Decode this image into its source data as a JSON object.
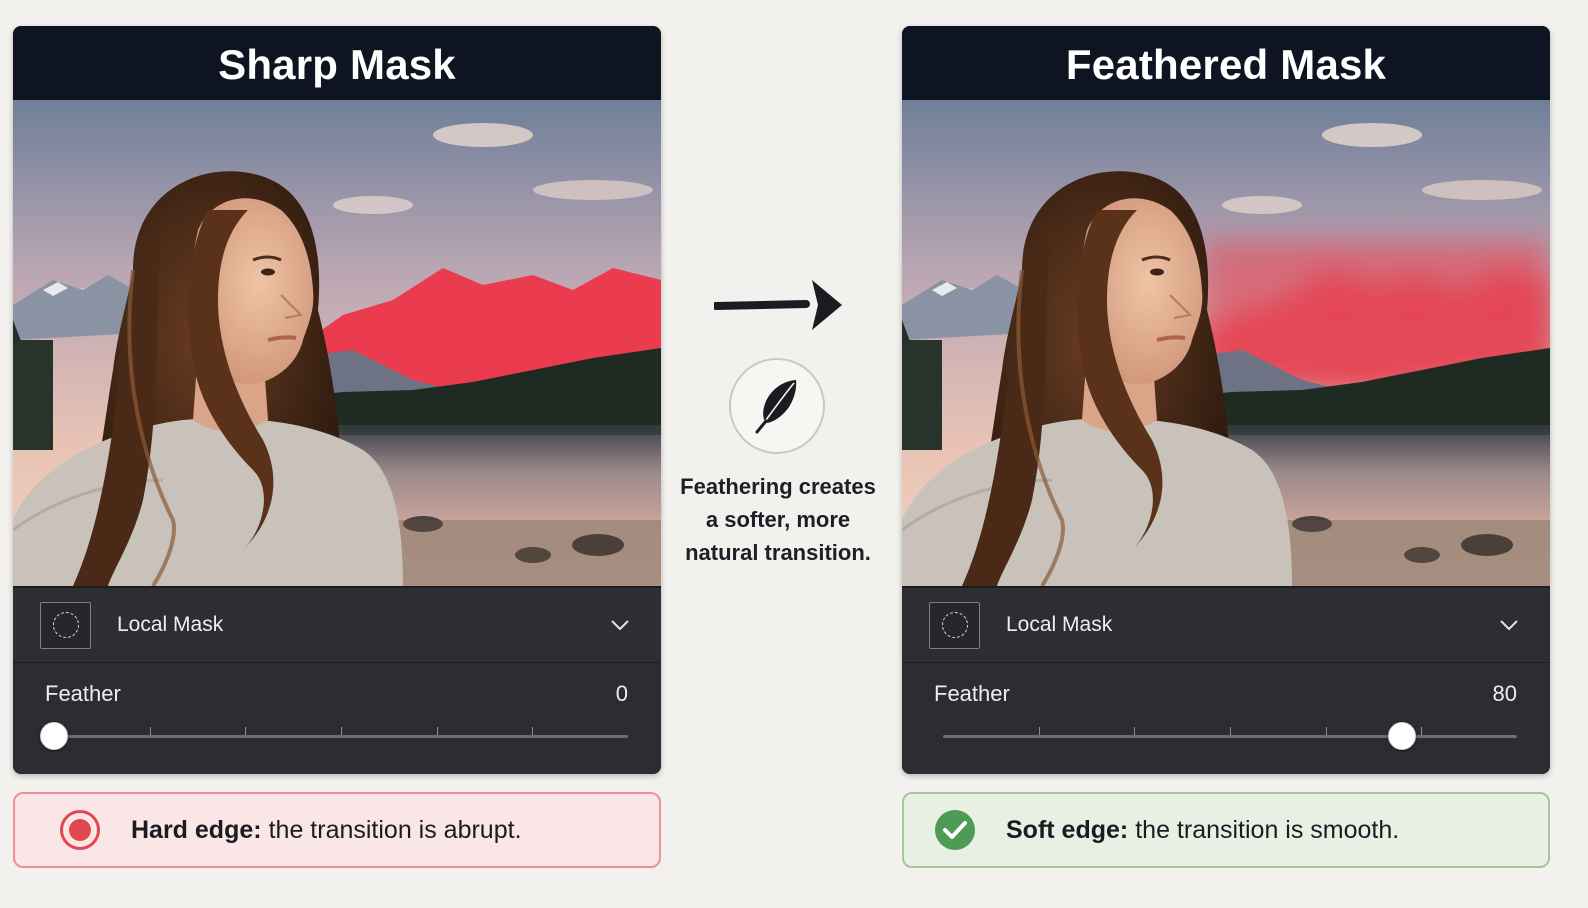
{
  "left_panel": {
    "title": "Sharp Mask",
    "mask_label": "Local Mask",
    "feather_label": "Feather",
    "feather_value": "0",
    "feather_fraction": 0.0
  },
  "right_panel": {
    "title": "Feathered Mask",
    "mask_label": "Local Mask",
    "feather_label": "Feather",
    "feather_value": "80",
    "feather_fraction": 0.8
  },
  "center": {
    "caption": "Feathering creates a softer, more natural transition."
  },
  "status_hard": {
    "bold": "Hard edge:",
    "text": "the transition is abrupt."
  },
  "status_soft": {
    "bold": "Soft edge:",
    "text": "the transition is smooth."
  },
  "icons": {
    "mask": "dashed-circle-icon",
    "dropdown": "chevron-down-icon",
    "center_arrow": "arrow-right-icon",
    "feather": "feather-icon",
    "hard_status": "record-dot-icon",
    "soft_status": "check-circle-icon"
  },
  "colors": {
    "mask_overlay": "#ea3c4e",
    "title_bar": "#0e1421",
    "hard_accent": "#e2474f",
    "soft_accent": "#4f9a55"
  }
}
